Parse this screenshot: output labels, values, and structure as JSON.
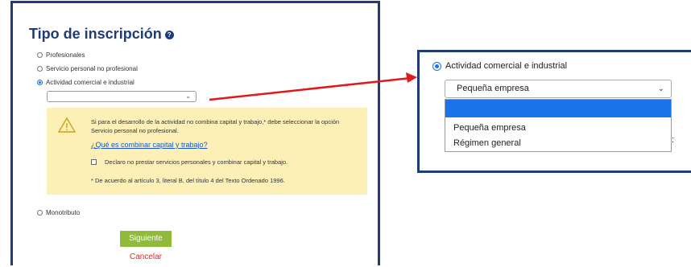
{
  "form": {
    "title": "Tipo de inscripción",
    "help_icon_name": "question-circle-icon",
    "options": [
      "Profesionales",
      "Servicio personal no profesional",
      "Actividad comercial e industrial",
      "Monotributo"
    ],
    "selected_option": "Actividad comercial e industrial",
    "select_value": "",
    "warning": {
      "icon_name": "warning-triangle-icon",
      "text": "Si para el desarrollo de la actividad no combina capital y trabajo,* debe seleccionar la opción Servicio personal no profesional.",
      "link": "¿Qué es combinar capital y trabajo?",
      "checkbox_label": "Declaro no prestar servicios personales y combinar capital y trabajo.",
      "footnote": "* De acuerdo al artículo 3, literal B, del título 4 del Texto Ordenado 1996."
    },
    "next_button": "Siguiente",
    "cancel_link": "Cancelar"
  },
  "zoom": {
    "radio_label": "Actividad comercial e industrial",
    "select_value": "Pequeña empresa",
    "dropdown_options": [
      "",
      "Pequeña empresa",
      "Régimen general"
    ],
    "highlighted_index": 0,
    "trailing_char": ":"
  },
  "colors": {
    "frame_border": "#1f3b78",
    "title": "#1f3b78",
    "warning_bg": "#fdf0b6",
    "link": "#1a56c8",
    "next_button_bg": "#8fba3a",
    "cancel_text": "#d32f2f",
    "highlight": "#1a73e8",
    "arrow": "#e0191c"
  }
}
